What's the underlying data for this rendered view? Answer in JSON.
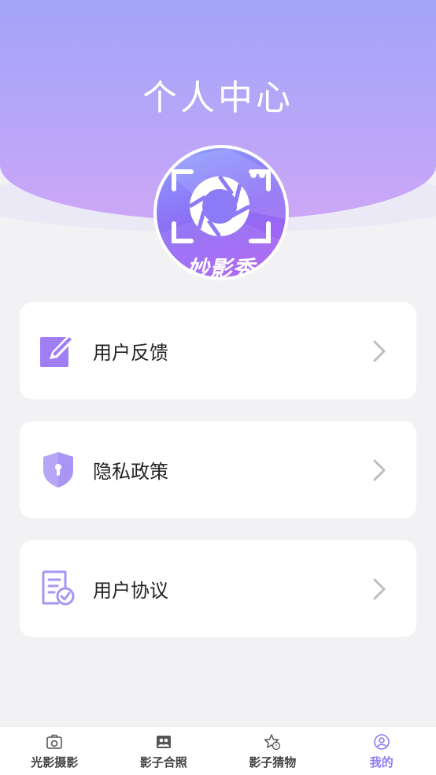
{
  "header": {
    "title": "个人中心"
  },
  "avatar": {
    "logo_text": "妙影秀"
  },
  "menu": [
    {
      "label": "用户反馈",
      "icon": "edit-icon"
    },
    {
      "label": "隐私政策",
      "icon": "shield-lock-icon"
    },
    {
      "label": "用户协议",
      "icon": "document-check-icon"
    }
  ],
  "tabbar": {
    "active": "我的",
    "tabs": [
      {
        "label": "光影摄影",
        "icon": "photo-icon"
      },
      {
        "label": "影子合照",
        "icon": "group-photo-icon"
      },
      {
        "label": "影子猜物",
        "icon": "star-question-icon"
      },
      {
        "label": "我的",
        "icon": "user-icon"
      }
    ]
  },
  "colors": {
    "accent": "#8f7cf4",
    "header_top": "#a3a4f8",
    "header_bottom": "#cda7f7"
  }
}
